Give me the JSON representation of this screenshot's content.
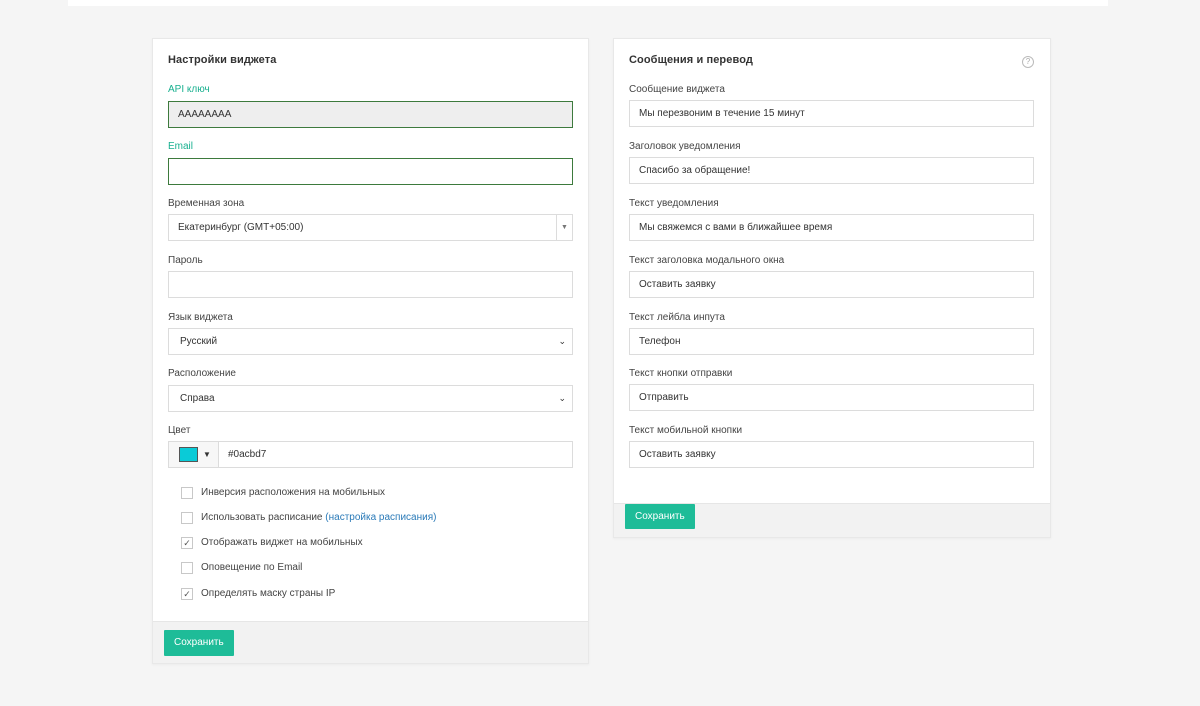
{
  "widget_settings": {
    "title": "Настройки виджета",
    "api_key": {
      "label": "API ключ",
      "value": "AAAAAAAA"
    },
    "email": {
      "label": "Email",
      "value": ""
    },
    "timezone": {
      "label": "Временная зона",
      "value": "Екатеринбург (GMT+05:00)"
    },
    "password": {
      "label": "Пароль",
      "value": ""
    },
    "language": {
      "label": "Язык виджета",
      "value": "Русский"
    },
    "position": {
      "label": "Расположение",
      "value": "Справа"
    },
    "color": {
      "label": "Цвет",
      "value": "#0acbd7",
      "swatch": "#0acbd7"
    },
    "checkboxes": [
      {
        "label": "Инверсия расположения на мобильных",
        "checked": false
      },
      {
        "label": "Использовать расписание",
        "link": "(настройка расписания)",
        "checked": false
      },
      {
        "label": "Отображать виджет на мобильных",
        "checked": true
      },
      {
        "label": "Оповещение по Email",
        "checked": false
      },
      {
        "label": "Определять маску страны IP",
        "checked": true
      }
    ],
    "save_label": "Сохранить"
  },
  "messages": {
    "title": "Сообщения и перевод",
    "help_icon": "?",
    "fields": [
      {
        "label": "Сообщение виджета",
        "value": "Мы перезвоним в течение 15 минут"
      },
      {
        "label": "Заголовок уведомления",
        "value": "Спасибо за обращение!"
      },
      {
        "label": "Текст уведомления",
        "value": "Мы свяжемся с вами в ближайшее время"
      },
      {
        "label": "Текст заголовка модального окна",
        "value": "Оставить заявку"
      },
      {
        "label": "Текст лейбла инпута",
        "value": "Телефон"
      },
      {
        "label": "Текст кнопки отправки",
        "value": "Отправить"
      },
      {
        "label": "Текст мобильной кнопки",
        "value": "Оставить заявку"
      }
    ],
    "save_label": "Сохранить"
  },
  "colors": {
    "accent": "#1ebc98",
    "link": "#2a7ab8"
  }
}
